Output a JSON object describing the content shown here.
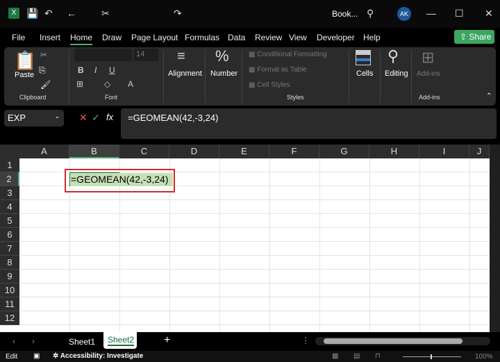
{
  "title": "Book...",
  "user_initials": "AK",
  "menu": [
    "File",
    "Insert",
    "Home",
    "Draw",
    "Page Layout",
    "Formulas",
    "Data",
    "Review",
    "View",
    "Developer",
    "Help"
  ],
  "share": "Share",
  "ribbon": {
    "paste": "Paste",
    "clipboard": "Clipboard",
    "font_size": "14",
    "font": "Font",
    "alignment": "Alignment",
    "number": "Number",
    "conditional": "Conditional Formatting",
    "format_table": "Format as Table",
    "cell_styles": "Cell Styles",
    "styles": "Styles",
    "cells": "Cells",
    "editing": "Editing",
    "addins": "Add-ins",
    "addins_group": "Add-ins"
  },
  "name_box": "EXP",
  "formula": "=GEOMEAN(42,-3,24)",
  "columns": [
    "A",
    "B",
    "C",
    "D",
    "E",
    "F",
    "G",
    "H",
    "I",
    "J"
  ],
  "rows": [
    "1",
    "2",
    "3",
    "4",
    "5",
    "6",
    "7",
    "8",
    "9",
    "10",
    "11",
    "12"
  ],
  "cell_b2": "=GEOMEAN(42,-3,24)",
  "sheets": [
    "Sheet1",
    "Sheet2"
  ],
  "active_sheet": "Sheet2",
  "status": {
    "mode": "Edit",
    "accessibility": "Accessibility: Investigate",
    "zoom": "100%"
  }
}
